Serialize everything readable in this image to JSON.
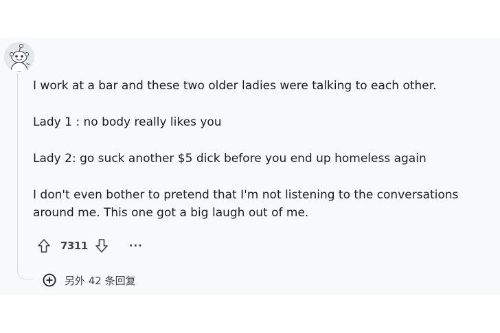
{
  "comment": {
    "paragraphs": [
      "I work at a bar and these two older ladies were talking to each other.",
      "Lady 1 : no body really likes you",
      "Lady 2: go suck another $5 dick before you end up homeless again",
      "I don't even bother to pretend that I'm not listening to the conversations around me. This one got a big laugh out of me."
    ],
    "vote_count": "7311",
    "more_label": "···",
    "more_replies_label": "另外 42 条回复",
    "icons": {
      "avatar": "snoo-avatar-icon",
      "upvote": "upvote-arrow-icon",
      "downvote": "downvote-arrow-icon",
      "more": "more-dots-icon",
      "expand": "plus-circle-icon"
    },
    "colors": {
      "background": "#f7f9fa",
      "text": "#1c1c1c",
      "muted": "#3b4147",
      "thread_line": "#d8dde0"
    }
  }
}
